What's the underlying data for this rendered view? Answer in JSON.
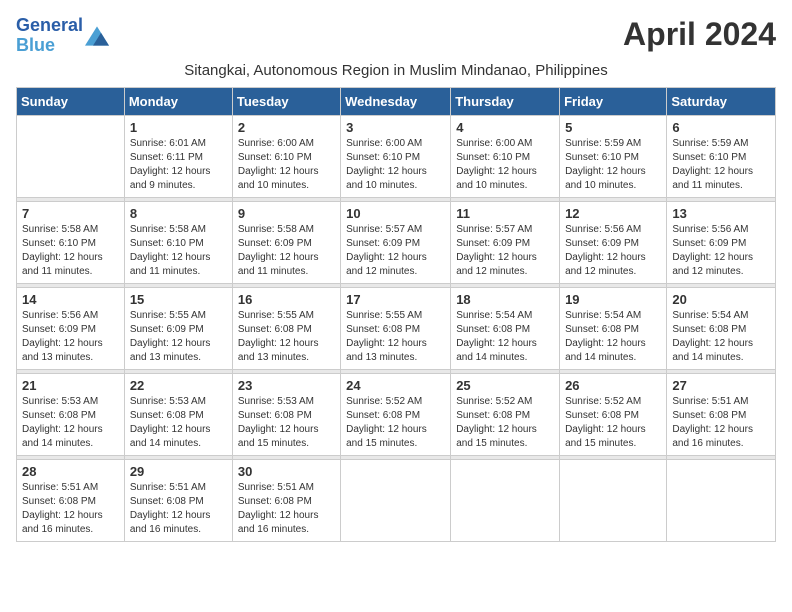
{
  "app": {
    "logo_line1": "General",
    "logo_line2": "Blue",
    "title": "April 2024",
    "subtitle": "Sitangkai, Autonomous Region in Muslim Mindanao, Philippines"
  },
  "calendar": {
    "headers": [
      "Sunday",
      "Monday",
      "Tuesday",
      "Wednesday",
      "Thursday",
      "Friday",
      "Saturday"
    ],
    "weeks": [
      [
        {
          "day": "",
          "info": ""
        },
        {
          "day": "1",
          "info": "Sunrise: 6:01 AM\nSunset: 6:11 PM\nDaylight: 12 hours\nand 9 minutes."
        },
        {
          "day": "2",
          "info": "Sunrise: 6:00 AM\nSunset: 6:10 PM\nDaylight: 12 hours\nand 10 minutes."
        },
        {
          "day": "3",
          "info": "Sunrise: 6:00 AM\nSunset: 6:10 PM\nDaylight: 12 hours\nand 10 minutes."
        },
        {
          "day": "4",
          "info": "Sunrise: 6:00 AM\nSunset: 6:10 PM\nDaylight: 12 hours\nand 10 minutes."
        },
        {
          "day": "5",
          "info": "Sunrise: 5:59 AM\nSunset: 6:10 PM\nDaylight: 12 hours\nand 10 minutes."
        },
        {
          "day": "6",
          "info": "Sunrise: 5:59 AM\nSunset: 6:10 PM\nDaylight: 12 hours\nand 11 minutes."
        }
      ],
      [
        {
          "day": "7",
          "info": "Sunrise: 5:58 AM\nSunset: 6:10 PM\nDaylight: 12 hours\nand 11 minutes."
        },
        {
          "day": "8",
          "info": "Sunrise: 5:58 AM\nSunset: 6:10 PM\nDaylight: 12 hours\nand 11 minutes."
        },
        {
          "day": "9",
          "info": "Sunrise: 5:58 AM\nSunset: 6:09 PM\nDaylight: 12 hours\nand 11 minutes."
        },
        {
          "day": "10",
          "info": "Sunrise: 5:57 AM\nSunset: 6:09 PM\nDaylight: 12 hours\nand 12 minutes."
        },
        {
          "day": "11",
          "info": "Sunrise: 5:57 AM\nSunset: 6:09 PM\nDaylight: 12 hours\nand 12 minutes."
        },
        {
          "day": "12",
          "info": "Sunrise: 5:56 AM\nSunset: 6:09 PM\nDaylight: 12 hours\nand 12 minutes."
        },
        {
          "day": "13",
          "info": "Sunrise: 5:56 AM\nSunset: 6:09 PM\nDaylight: 12 hours\nand 12 minutes."
        }
      ],
      [
        {
          "day": "14",
          "info": "Sunrise: 5:56 AM\nSunset: 6:09 PM\nDaylight: 12 hours\nand 13 minutes."
        },
        {
          "day": "15",
          "info": "Sunrise: 5:55 AM\nSunset: 6:09 PM\nDaylight: 12 hours\nand 13 minutes."
        },
        {
          "day": "16",
          "info": "Sunrise: 5:55 AM\nSunset: 6:08 PM\nDaylight: 12 hours\nand 13 minutes."
        },
        {
          "day": "17",
          "info": "Sunrise: 5:55 AM\nSunset: 6:08 PM\nDaylight: 12 hours\nand 13 minutes."
        },
        {
          "day": "18",
          "info": "Sunrise: 5:54 AM\nSunset: 6:08 PM\nDaylight: 12 hours\nand 14 minutes."
        },
        {
          "day": "19",
          "info": "Sunrise: 5:54 AM\nSunset: 6:08 PM\nDaylight: 12 hours\nand 14 minutes."
        },
        {
          "day": "20",
          "info": "Sunrise: 5:54 AM\nSunset: 6:08 PM\nDaylight: 12 hours\nand 14 minutes."
        }
      ],
      [
        {
          "day": "21",
          "info": "Sunrise: 5:53 AM\nSunset: 6:08 PM\nDaylight: 12 hours\nand 14 minutes."
        },
        {
          "day": "22",
          "info": "Sunrise: 5:53 AM\nSunset: 6:08 PM\nDaylight: 12 hours\nand 14 minutes."
        },
        {
          "day": "23",
          "info": "Sunrise: 5:53 AM\nSunset: 6:08 PM\nDaylight: 12 hours\nand 15 minutes."
        },
        {
          "day": "24",
          "info": "Sunrise: 5:52 AM\nSunset: 6:08 PM\nDaylight: 12 hours\nand 15 minutes."
        },
        {
          "day": "25",
          "info": "Sunrise: 5:52 AM\nSunset: 6:08 PM\nDaylight: 12 hours\nand 15 minutes."
        },
        {
          "day": "26",
          "info": "Sunrise: 5:52 AM\nSunset: 6:08 PM\nDaylight: 12 hours\nand 15 minutes."
        },
        {
          "day": "27",
          "info": "Sunrise: 5:51 AM\nSunset: 6:08 PM\nDaylight: 12 hours\nand 16 minutes."
        }
      ],
      [
        {
          "day": "28",
          "info": "Sunrise: 5:51 AM\nSunset: 6:08 PM\nDaylight: 12 hours\nand 16 minutes."
        },
        {
          "day": "29",
          "info": "Sunrise: 5:51 AM\nSunset: 6:08 PM\nDaylight: 12 hours\nand 16 minutes."
        },
        {
          "day": "30",
          "info": "Sunrise: 5:51 AM\nSunset: 6:08 PM\nDaylight: 12 hours\nand 16 minutes."
        },
        {
          "day": "",
          "info": ""
        },
        {
          "day": "",
          "info": ""
        },
        {
          "day": "",
          "info": ""
        },
        {
          "day": "",
          "info": ""
        }
      ]
    ]
  }
}
